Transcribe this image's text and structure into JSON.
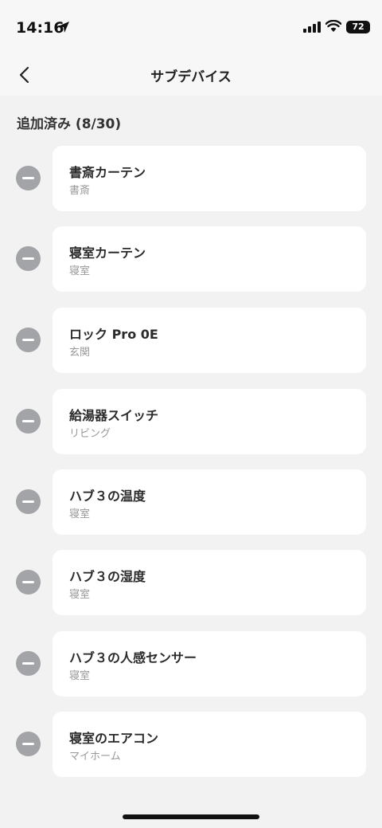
{
  "status_bar": {
    "time": "14:16",
    "battery": "72"
  },
  "nav": {
    "title": "サブデバイス"
  },
  "section": {
    "header": "追加済み (8/30)"
  },
  "devices": [
    {
      "name": "書斎カーテン",
      "room": "書斎"
    },
    {
      "name": "寝室カーテン",
      "room": "寝室"
    },
    {
      "name": "ロック Pro 0E",
      "room": "玄関"
    },
    {
      "name": "給湯器スイッチ",
      "room": "リビング"
    },
    {
      "name": "ハブ３の温度",
      "room": "寝室"
    },
    {
      "name": "ハブ３の湿度",
      "room": "寝室"
    },
    {
      "name": "ハブ３の人感センサー",
      "room": "寝室"
    },
    {
      "name": "寝室のエアコン",
      "room": "マイホーム"
    }
  ]
}
